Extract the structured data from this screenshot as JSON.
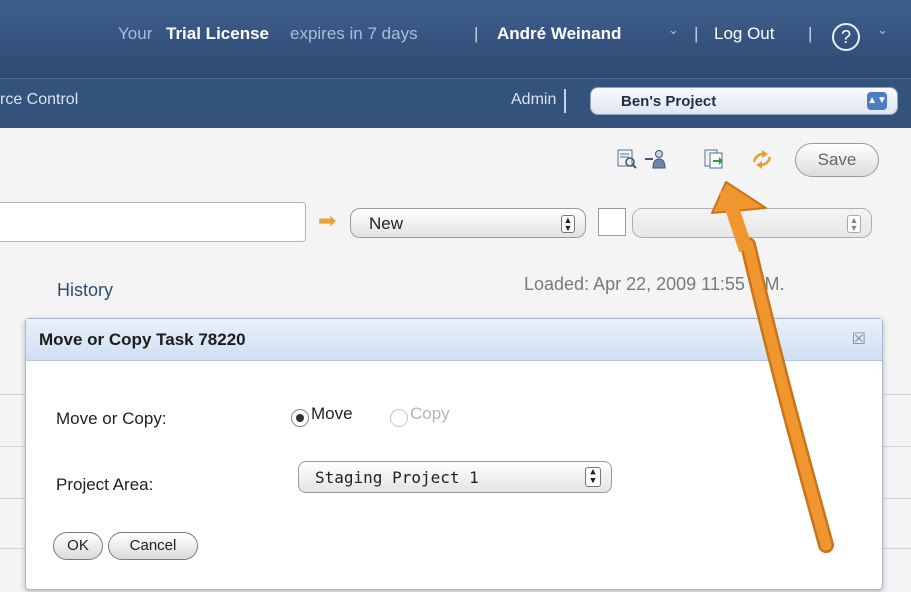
{
  "header": {
    "license_prefix": "Your",
    "license_strong": "Trial License",
    "license_suffix": "expires in 7 days",
    "separator": "|",
    "user_name": "André Weinand",
    "user_chevron": "⌄",
    "logout_label": "Log Out",
    "help_label": "?",
    "help_chevron": "⌄"
  },
  "nav": {
    "left_link": "rce Control",
    "admin_label": "Admin",
    "project_select_value": "Ben's Project"
  },
  "toolbar": {
    "icons": [
      "find-icon",
      "assign-user-icon",
      "move-copy-icon",
      "refresh-icon"
    ],
    "save_label": "Save"
  },
  "form": {
    "state_value": "New",
    "action_value": ""
  },
  "tabs": {
    "history_label": "History"
  },
  "status": {
    "loaded_text": "Loaded: Apr 22, 2009 11:55 P.M."
  },
  "dialog": {
    "title": "Move or Copy Task 78220",
    "close_glyph": "☒",
    "move_copy_label": "Move or Copy:",
    "move_option": "Move",
    "copy_option": "Copy",
    "selected_option": "Move",
    "project_area_label": "Project Area:",
    "project_area_value": "Staging Project 1",
    "ok_label": "OK",
    "cancel_label": "Cancel"
  },
  "colors": {
    "header_bg": "#2c4a74",
    "nav_bg": "#33527c",
    "link_blue": "#2e4b74",
    "annotation_orange": "#f0962e"
  }
}
